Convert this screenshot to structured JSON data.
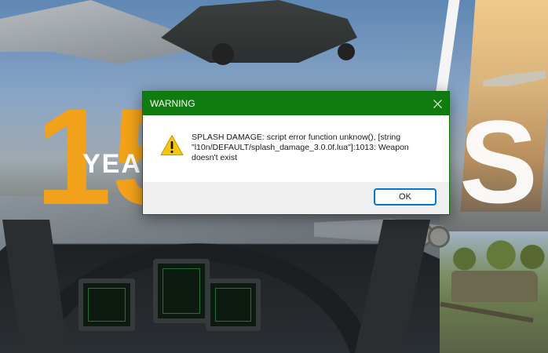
{
  "background": {
    "banner_digits": "15",
    "banner_word": "YEA",
    "banner_letter": "S",
    "accent_color": "#f2a21a"
  },
  "dialog": {
    "title": "WARNING",
    "titlebar_color": "#107c10",
    "icon": "warning-icon",
    "message": "SPLASH DAMAGE:  script error function unknow(), [string \"l10n/DEFAULT/splash_damage_3.0.0f.lua\"]:1013: Weapon doesn't exist",
    "ok_label": "OK",
    "close_icon": "close-icon"
  }
}
